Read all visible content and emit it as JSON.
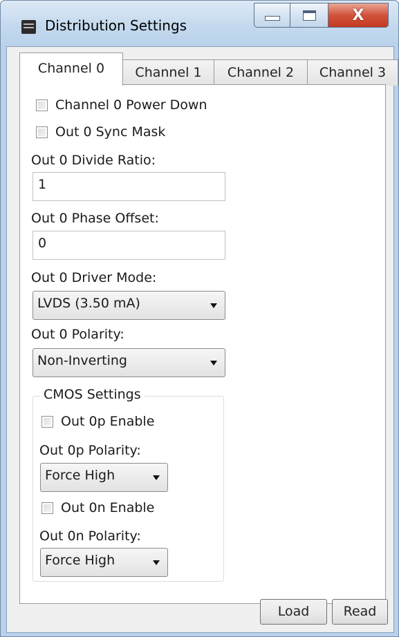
{
  "window": {
    "title": "Distribution Settings",
    "close_glyph": "X"
  },
  "tabs": [
    {
      "label": "Channel 0",
      "active": true
    },
    {
      "label": "Channel 1",
      "active": false
    },
    {
      "label": "Channel 2",
      "active": false
    },
    {
      "label": "Channel 3",
      "active": false
    }
  ],
  "panel": {
    "power_down_label": "Channel 0 Power Down",
    "sync_mask_label": "Out 0 Sync Mask",
    "divide_ratio_label": "Out 0 Divide Ratio:",
    "divide_ratio_value": "1",
    "phase_offset_label": "Out 0 Phase Offset:",
    "phase_offset_value": "0",
    "driver_mode_label": "Out 0 Driver Mode:",
    "driver_mode_value": "LVDS (3.50 mA)",
    "polarity_label": "Out 0 Polarity:",
    "polarity_value": "Non-Inverting"
  },
  "cmos": {
    "legend": "CMOS Settings",
    "out_p_enable_label": "Out 0p Enable",
    "out_p_polarity_label": "Out 0p Polarity:",
    "out_p_polarity_value": "Force High",
    "out_n_enable_label": "Out 0n Enable",
    "out_n_polarity_label": "Out 0n Polarity:",
    "out_n_polarity_value": "Force High"
  },
  "buttons": {
    "load": "Load",
    "read": "Read"
  }
}
